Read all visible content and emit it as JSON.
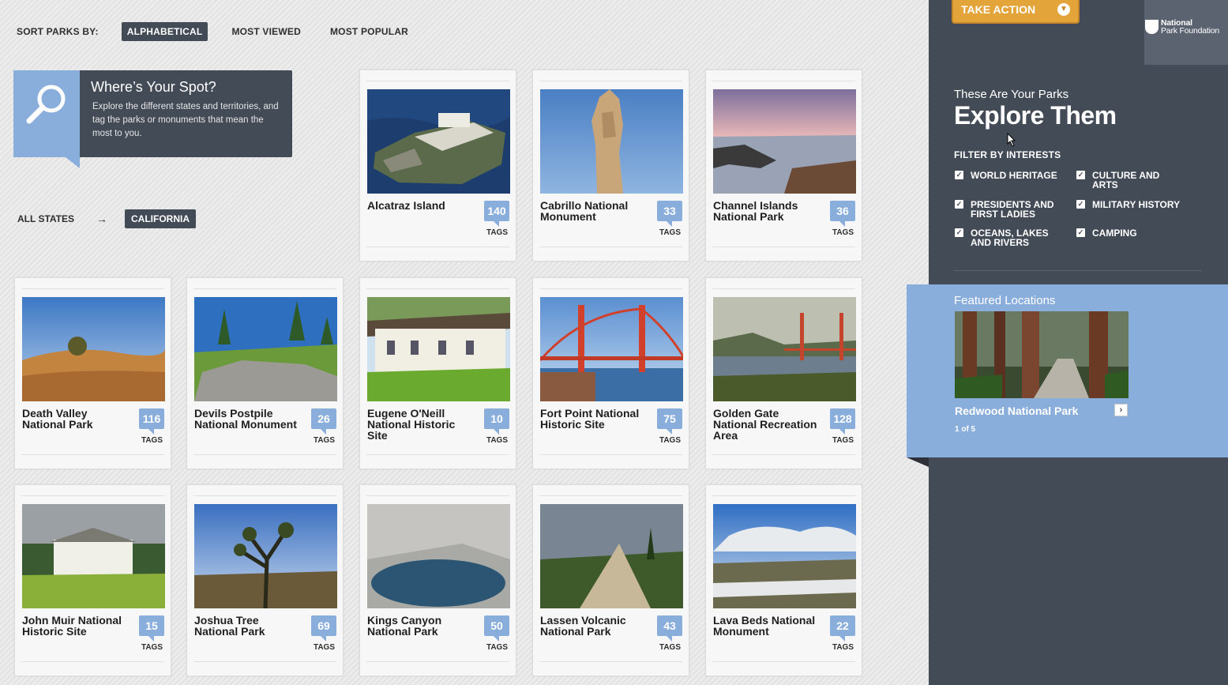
{
  "sort": {
    "label": "SORT PARKS BY:",
    "options": [
      "ALPHABETICAL",
      "MOST VIEWED",
      "MOST POPULAR"
    ],
    "active": "ALPHABETICAL"
  },
  "spot": {
    "title": "Where’s Your Spot?",
    "text": "Explore the different states and territories, and tag the parks or monuments that mean the most to you."
  },
  "state_filter": {
    "all_label": "ALL STATES",
    "arrow": "→",
    "selected": "CALIFORNIA"
  },
  "tags_label": "TAGS",
  "parks": [
    {
      "name": "Alcatraz Island",
      "tags": "140"
    },
    {
      "name": "Cabrillo National Monument",
      "tags": "33"
    },
    {
      "name": "Channel Islands National Park",
      "tags": "36"
    },
    {
      "name": "Death Valley National Park",
      "tags": "116"
    },
    {
      "name": "Devils Postpile National Monument",
      "tags": "26"
    },
    {
      "name": "Eugene O'Neill National Historic Site",
      "tags": "10"
    },
    {
      "name": "Fort Point National Historic Site",
      "tags": "75"
    },
    {
      "name": "Golden Gate National Recreation Area",
      "tags": "128"
    },
    {
      "name": "John Muir National Historic Site",
      "tags": "15"
    },
    {
      "name": "Joshua Tree National Park",
      "tags": "69"
    },
    {
      "name": "Kings Canyon National Park",
      "tags": "50"
    },
    {
      "name": "Lassen Volcanic National Park",
      "tags": "43"
    },
    {
      "name": "Lava Beds National Monument",
      "tags": "22"
    }
  ],
  "sidebar": {
    "take_action": "TAKE ACTION",
    "org_line1": "National",
    "org_line2": "Park Foundation",
    "kicker": "These Are Your Parks",
    "title": "Explore Them",
    "filter_label": "FILTER BY INTERESTS",
    "filters": [
      {
        "line1": "WORLD HERITAGE",
        "line2": "",
        "checked": true
      },
      {
        "line1": "CULTURE AND",
        "line2": "ARTS",
        "checked": true
      },
      {
        "line1": "PRESIDENTS AND",
        "line2": "FIRST LADIES",
        "checked": true
      },
      {
        "line1": "MILITARY HISTORY",
        "line2": "",
        "checked": true
      },
      {
        "line1": "OCEANS, LAKES",
        "line2": "AND RIVERS",
        "checked": true
      },
      {
        "line1": "CAMPING",
        "line2": "",
        "checked": true
      }
    ],
    "featured": {
      "label": "Featured Locations",
      "name": "Redwood National Park",
      "next": "›",
      "count": "1 of 5"
    }
  },
  "colors": {
    "dark": "#434b57",
    "accent_blue": "#8aaedc",
    "action_orange": "#e3a43a"
  }
}
